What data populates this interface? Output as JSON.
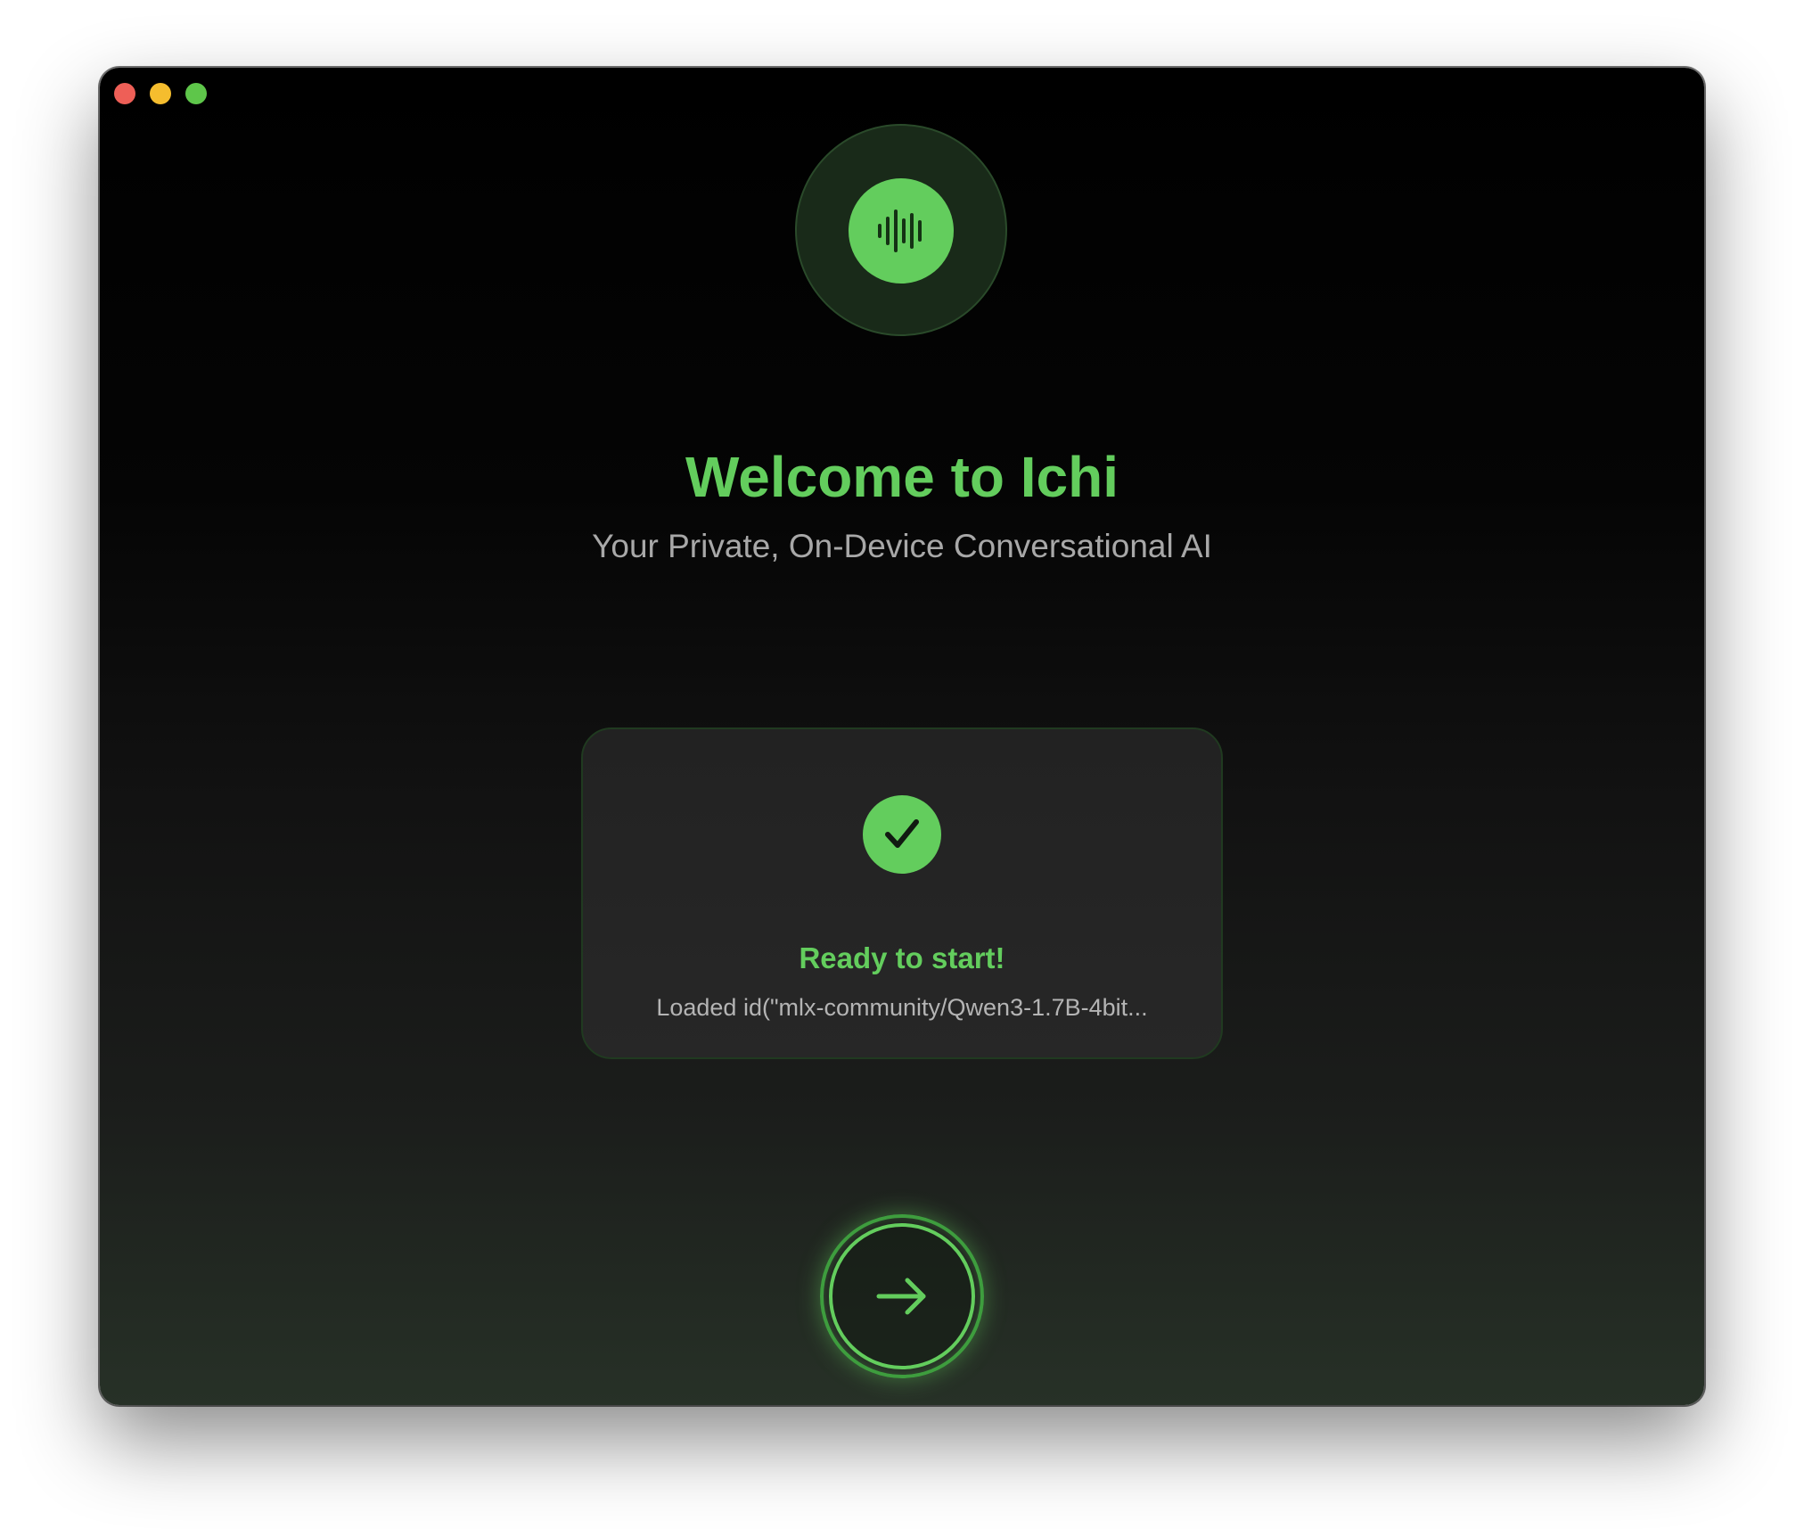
{
  "window": {
    "controls": [
      "close",
      "minimize",
      "zoom"
    ]
  },
  "hero": {
    "icon": "waveform-icon",
    "title": "Welcome to Ichi",
    "subtitle": "Your Private, On-Device Conversational AI"
  },
  "status": {
    "icon": "checkmark-icon",
    "title": "Ready to start!",
    "detail": "Loaded id(\"mlx-community/Qwen3-1.7B-4bit..."
  },
  "next": {
    "icon": "arrow-right-icon"
  },
  "colors": {
    "accent": "#63cd5d",
    "close": "#ee5f57",
    "minimize": "#f5bd2e",
    "zoom": "#5ec64a"
  }
}
